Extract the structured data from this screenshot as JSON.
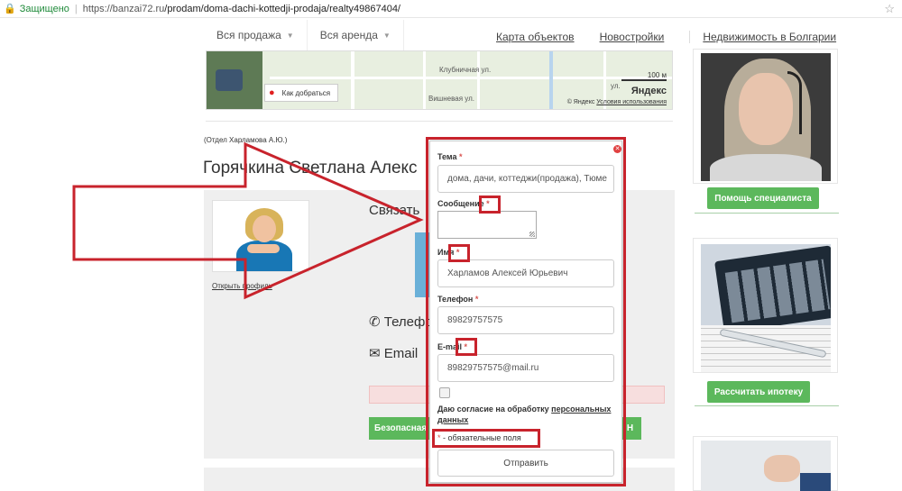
{
  "browser": {
    "secure_label": "Защищено",
    "url_host": "https://banzai72.ru",
    "url_path": "/prodam/doma-dachi-kottedji-prodaja/realty49867404/"
  },
  "nav": {
    "sale_label": "Вся продажа",
    "rent_label": "Вся аренда",
    "links": [
      "Карта объектов",
      "Новостройки",
      "Недвижимость в Болгарии"
    ]
  },
  "map": {
    "street1": "Клубничная ул.",
    "street2": "Вишневая ул.",
    "street3": "ул.",
    "route_label": "Как добраться",
    "scale_label": "100 м",
    "brand": "Яндекс",
    "copyright": "© Яндекс",
    "terms": "Условия использования"
  },
  "agent": {
    "department": "(Отдел Харламова А.Ю.)",
    "name": "Горячкина Светлана Алекс",
    "open_profile": "Открыть профиль",
    "contact_heading": "Связать",
    "phone_label": "Телефо",
    "email_label": "Email",
    "safe_button": "Безопасная с",
    "right_button": "Н"
  },
  "sidebar": {
    "help_button": "Помощь специалиста",
    "mortgage_button": "Рассчитать ипотеку"
  },
  "modal": {
    "subject_label": "Тема",
    "subject_value": "дома, дачи, коттеджи(продажа), Тюме",
    "message_label": "Сообщение",
    "name_label": "Имя",
    "name_value": "Харламов Алексей Юрьевич",
    "phone_label": "Телефон",
    "phone_value": "89829757575",
    "email_label": "E-mail",
    "email_value": "89829757575@mail.ru",
    "consent_text": "Даю согласие на обработку",
    "consent_link": "персональных данных",
    "required_note": "- обязательные поля",
    "required_star": "*",
    "submit_label": "Отправить",
    "consent_checked": false
  },
  "colors": {
    "annotation_red": "#c8232c",
    "button_green": "#5cb85c",
    "required_red": "#d9534f"
  }
}
